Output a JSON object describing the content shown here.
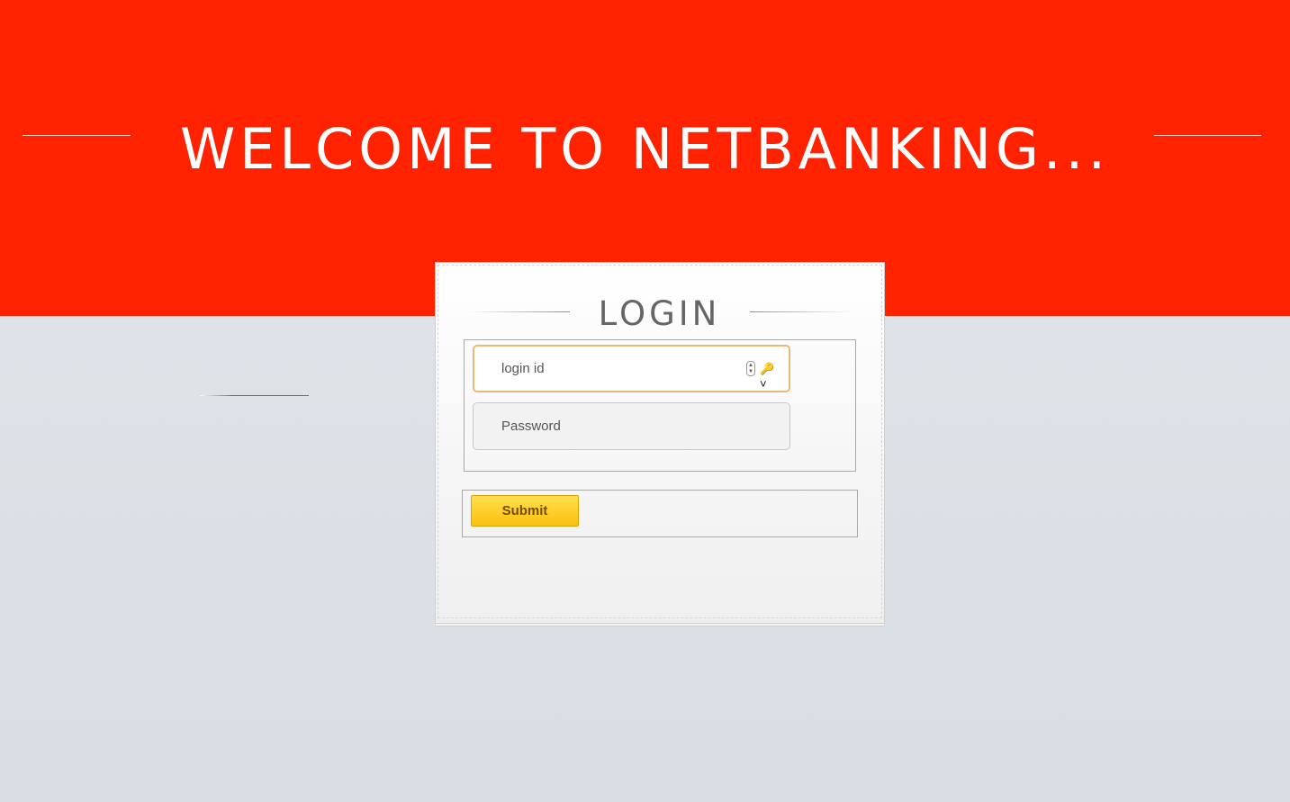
{
  "header": {
    "title": "WELCOME TO NETBANKING..."
  },
  "login": {
    "title": "LOGIN",
    "login_id_placeholder": "login id",
    "password_placeholder": "Password",
    "submit_label": "Submit"
  },
  "icons": {
    "autofill": "stepper-icon",
    "key": "key-icon"
  },
  "colors": {
    "banner": "#ff2200",
    "background": "#dde1e6",
    "submit_button": "#fcc00e",
    "focus_border": "#e8b878"
  }
}
